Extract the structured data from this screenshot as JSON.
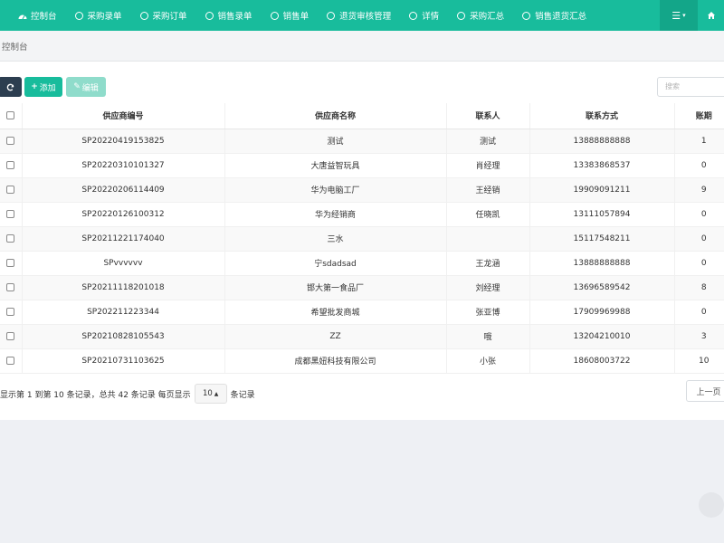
{
  "nav": {
    "tabs": [
      {
        "label": "控制台",
        "icon": "dashboard-icon"
      },
      {
        "label": "采购录单",
        "icon": "circle-icon"
      },
      {
        "label": "采购订单",
        "icon": "circle-icon"
      },
      {
        "label": "销售录单",
        "icon": "circle-icon"
      },
      {
        "label": "销售单",
        "icon": "circle-icon"
      },
      {
        "label": "退货审核管理",
        "icon": "circle-icon"
      },
      {
        "label": "详情",
        "icon": "circle-icon"
      },
      {
        "label": "采购汇总",
        "icon": "circle-icon"
      },
      {
        "label": "销售退货汇总",
        "icon": "circle-icon"
      }
    ],
    "menu_icon": "list-icon",
    "home_icon": "home-icon",
    "accent": "#18bc9c"
  },
  "breadcrumb": "控制台",
  "toolbar": {
    "refresh_icon": "refresh-icon",
    "add_label": "添加",
    "edit_label": "编辑",
    "search_placeholder": "搜索"
  },
  "table": {
    "columns": [
      "供应商编号",
      "供应商名称",
      "联系人",
      "联系方式",
      "账期"
    ],
    "rows": [
      {
        "code": "SP20220419153825",
        "name": "测试",
        "contact": "测试",
        "phone": "13888888888",
        "term": "1"
      },
      {
        "code": "SP20220310101327",
        "name": "大唐益智玩具",
        "contact": "肖经理",
        "phone": "13383868537",
        "term": "0"
      },
      {
        "code": "SP20220206114409",
        "name": "华为电脑工厂",
        "contact": "王经销",
        "phone": "19909091211",
        "term": "9"
      },
      {
        "code": "SP20220126100312",
        "name": "华为经销商",
        "contact": "任晓凯",
        "phone": "13111057894",
        "term": "0"
      },
      {
        "code": "SP20211221174040",
        "name": "三水",
        "contact": "",
        "phone": "15117548211",
        "term": "0"
      },
      {
        "code": "SPvvvvvv",
        "name": "宁sdadsad",
        "contact": "王龙涵",
        "phone": "13888888888",
        "term": "0"
      },
      {
        "code": "SP20211118201018",
        "name": "邯大第一食品厂",
        "contact": "刘经理",
        "phone": "13696589542",
        "term": "8"
      },
      {
        "code": "SP202211223344",
        "name": "希望批发商城",
        "contact": "张亚博",
        "phone": "17909969988",
        "term": "0"
      },
      {
        "code": "SP20210828105543",
        "name": "ZZ",
        "contact": "哦",
        "phone": "13204210010",
        "term": "3"
      },
      {
        "code": "SP20210731103625",
        "name": "成都黑妞科技有限公司",
        "contact": "小张",
        "phone": "18608003722",
        "term": "10"
      }
    ]
  },
  "pager": {
    "info_text": "显示第 1 到第 10 条记录，总共 42 条记录 每页显示",
    "page_size": "10",
    "after_text": "条记录",
    "prev_label": "上一页"
  }
}
